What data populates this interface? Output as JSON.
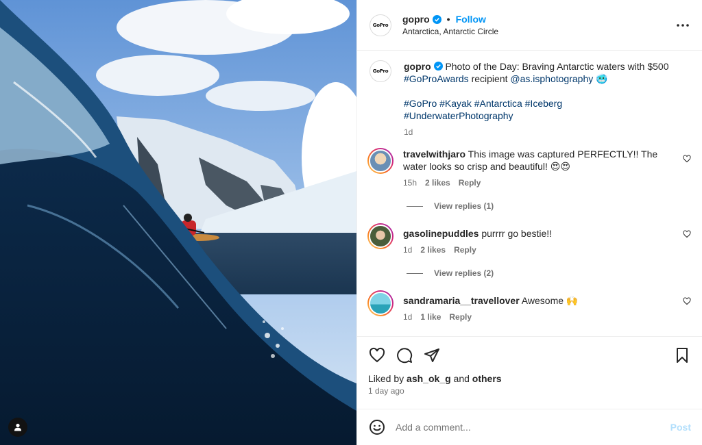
{
  "photo": {
    "alt_icon": "user-silhouette-icon"
  },
  "header": {
    "username": "gopro",
    "separator": "•",
    "follow_label": "Follow",
    "location": "Antarctica, Antarctic Circle",
    "more_icon": "more-horizontal-icon"
  },
  "caption": {
    "username": "gopro",
    "text_1": "Photo of the Day: Braving Antarctic waters with $500",
    "tag_awards": "#GoProAwards",
    "text_2": " recipient ",
    "mention": "@as.isphotography",
    "emoji": "🥶",
    "hashtags": "#GoPro #Kayak #Antarctica #Iceberg",
    "hashtags_2": "#UnderwaterPhotography",
    "time": "1d"
  },
  "comments": [
    {
      "username": "travelwithjaro",
      "text": "This image was captured PERFECTLY!! The water looks so crisp and beautiful! 😍😍",
      "time": "15h",
      "likes": "2 likes",
      "reply": "Reply",
      "view_replies": "View replies (1)"
    },
    {
      "username": "gasolinepuddles",
      "text": "purrrr go bestie!!",
      "time": "1d",
      "likes": "2 likes",
      "reply": "Reply",
      "view_replies": "View replies (2)"
    },
    {
      "username": "sandramaria__travellover",
      "text": "Awesome 🙌",
      "time": "1d",
      "likes": "1 like",
      "reply": "Reply"
    }
  ],
  "actions": {
    "liked_prefix": "Liked by ",
    "liked_user": "ash_ok_g",
    "liked_mid": " and ",
    "liked_others": "others",
    "time_ago": "1 day ago"
  },
  "add_comment": {
    "placeholder": "Add a comment...",
    "post_label": "Post"
  },
  "colors": {
    "accent": "#0095f6",
    "link": "#00376b",
    "muted": "#737373",
    "post_disabled": "#b2dffc"
  }
}
